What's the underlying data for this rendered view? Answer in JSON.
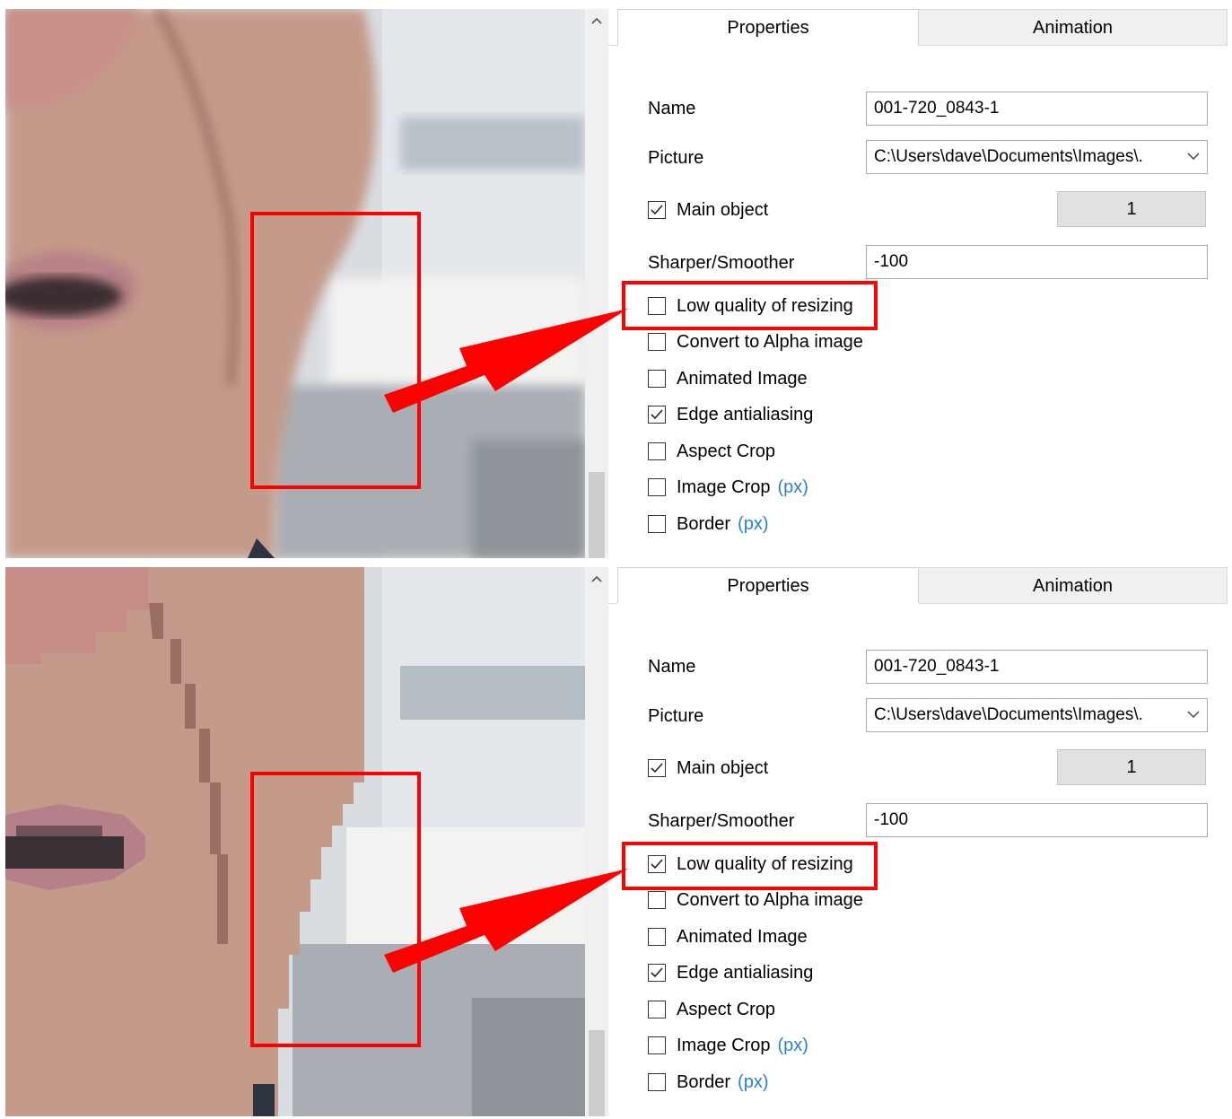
{
  "panels": [
    {
      "state": "before",
      "tabs": {
        "properties": "Properties",
        "animation": "Animation"
      },
      "name": {
        "label": "Name",
        "value": "001-720_0843-1"
      },
      "picture": {
        "label": "Picture",
        "value": "C:\\Users\\dave\\Documents\\Images\\."
      },
      "main_object": {
        "label": "Main object",
        "checked": true,
        "number": "1"
      },
      "sharper": {
        "label": "Sharper/Smoother",
        "value": "-100"
      },
      "checkboxes": [
        {
          "label": "Low quality of resizing",
          "checked": false
        },
        {
          "label": "Convert to Alpha image",
          "checked": false
        },
        {
          "label": "Animated Image",
          "checked": false
        },
        {
          "label": "Edge antialiasing",
          "checked": true
        },
        {
          "label": "Aspect Crop",
          "checked": false
        },
        {
          "label": "Image Crop",
          "suffix": "(px)",
          "checked": false
        },
        {
          "label": "Border",
          "suffix": "(px)",
          "checked": false
        }
      ]
    },
    {
      "state": "after",
      "tabs": {
        "properties": "Properties",
        "animation": "Animation"
      },
      "name": {
        "label": "Name",
        "value": "001-720_0843-1"
      },
      "picture": {
        "label": "Picture",
        "value": "C:\\Users\\dave\\Documents\\Images\\."
      },
      "main_object": {
        "label": "Main object",
        "checked": true,
        "number": "1"
      },
      "sharper": {
        "label": "Sharper/Smoother",
        "value": "-100"
      },
      "checkboxes": [
        {
          "label": "Low quality of resizing",
          "checked": true
        },
        {
          "label": "Convert to Alpha image",
          "checked": false
        },
        {
          "label": "Animated Image",
          "checked": false
        },
        {
          "label": "Edge antialiasing",
          "checked": true
        },
        {
          "label": "Aspect Crop",
          "checked": false
        },
        {
          "label": "Image Crop",
          "suffix": "(px)",
          "checked": false
        },
        {
          "label": "Border",
          "suffix": "(px)",
          "checked": false
        }
      ]
    }
  ],
  "icons": {
    "scroll_up": "chevron-up-icon",
    "dropdown": "chevron-down-icon",
    "check": "checkmark-icon"
  },
  "colors": {
    "highlight": "#ff0000",
    "link": "#2a7fd4",
    "skin": "#c8a090"
  }
}
